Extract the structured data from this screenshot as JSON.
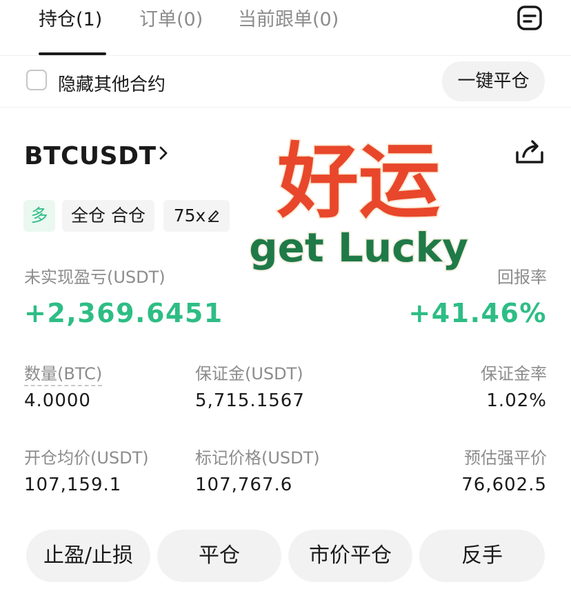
{
  "tabs": [
    {
      "label": "持仓(1)",
      "active": true
    },
    {
      "label": "订单(0)",
      "active": false
    },
    {
      "label": "当前跟单(0)",
      "active": false
    }
  ],
  "filter": {
    "hide_label": "隐藏其他合约",
    "close_all_label": "一键平仓"
  },
  "position": {
    "symbol": "BTCUSDT",
    "side_tag": "多",
    "margin_mode_tag": "全仓 合仓",
    "leverage_tag": "75x",
    "pnl_label": "未实现盈亏(USDT)",
    "pnl_value": "+2,369.6451",
    "roe_label": "回报率",
    "roe_value": "+41.46%",
    "qty_label": "数量(BTC)",
    "qty_value": "4.0000",
    "margin_label": "保证金(USDT)",
    "margin_value": "5,715.1567",
    "margin_ratio_label": "保证金率",
    "margin_ratio_value": "1.02%",
    "entry_label": "开仓均价(USDT)",
    "entry_value": "107,159.1",
    "mark_label": "标记价格(USDT)",
    "mark_value": "107,767.6",
    "liq_label": "预估强平价",
    "liq_value": "76,602.5"
  },
  "sticker": {
    "cn_text": "好运",
    "en_text": "get Lucky"
  },
  "actions": {
    "tpsl": "止盈/止损",
    "close": "平仓",
    "market_close": "市价平仓",
    "reverse": "反手"
  },
  "icons": {
    "orders": "document-list-icon",
    "share": "share-icon",
    "chevron": "chevron-right-icon",
    "edit": "pencil-icon"
  },
  "colors": {
    "profit": "#2ebd85",
    "sticker_red": "#e8472b",
    "sticker_green": "#1f7a48"
  }
}
